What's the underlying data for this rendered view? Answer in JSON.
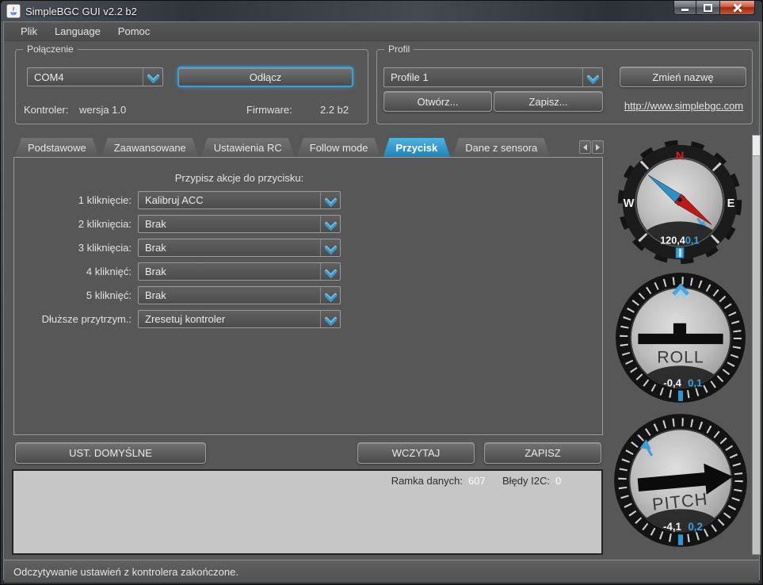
{
  "window": {
    "title": "SimpleBGC GUI v2.2 b2"
  },
  "menu": {
    "items": [
      {
        "label": "Plik"
      },
      {
        "label": "Language"
      },
      {
        "label": "Pomoc"
      }
    ]
  },
  "connection": {
    "group_title": "Połączenie",
    "port_value": "COM4",
    "disconnect_label": "Odłącz",
    "controller_label": "Kontroler:",
    "controller_value": "wersja 1.0",
    "firmware_label": "Firmware:",
    "firmware_value": "2.2 b2"
  },
  "profile": {
    "group_title": "Profil",
    "profile_value": "Profile 1",
    "rename_label": "Zmień nazwę",
    "open_label": "Otwórz...",
    "save_label": "Zapisz...",
    "link": "http://www.simplebgc.com"
  },
  "tabs": {
    "items": [
      {
        "label": "Podstawowe",
        "active": false
      },
      {
        "label": "Zaawansowane",
        "active": false
      },
      {
        "label": "Ustawienia RC",
        "active": false
      },
      {
        "label": "Follow mode",
        "active": false
      },
      {
        "label": "Przycisk",
        "active": true
      },
      {
        "label": "Dane z sensora",
        "active": false
      }
    ]
  },
  "button_tab": {
    "header": "Przypisz akcje do przycisku:",
    "rows": [
      {
        "label": "1 kliknięcie:",
        "value": "Kalibruj ACC"
      },
      {
        "label": "2 kliknięcia:",
        "value": "Brak"
      },
      {
        "label": "3 kliknięcia:",
        "value": "Brak"
      },
      {
        "label": "4 kliknięć:",
        "value": "Brak"
      },
      {
        "label": "5 kliknięć:",
        "value": "Brak"
      },
      {
        "label": "Dłuższe przytrzym.:",
        "value": "Zresetuj kontroler"
      }
    ]
  },
  "actions": {
    "defaults_label": "UST. DOMYŚLNE",
    "read_label": "WCZYTAJ",
    "write_label": "ZAPISZ"
  },
  "telemetry": {
    "frames_label": "Ramka danych:",
    "frames_value": "607",
    "i2c_label": "Błędy I2C:",
    "i2c_value": "0"
  },
  "statusbar": {
    "message": "Odczytywanie ustawień z kontrolera zakończone."
  },
  "gauges": {
    "compass": {
      "north": "N",
      "west": "W",
      "east": "E",
      "value": "120,4",
      "target": "0,1"
    },
    "roll": {
      "label": "ROLL",
      "value": "-0,4",
      "target": "0,1"
    },
    "pitch": {
      "label": "PITCH",
      "value": "-4,1",
      "target": "0,2"
    }
  },
  "colors": {
    "accent": "#369fd6",
    "tab_active": "#2f95c8",
    "north_red": "#d32020",
    "value_white": "#f5f5f5",
    "window_bg": "#575757",
    "log_bg": "#c6c6c6"
  }
}
